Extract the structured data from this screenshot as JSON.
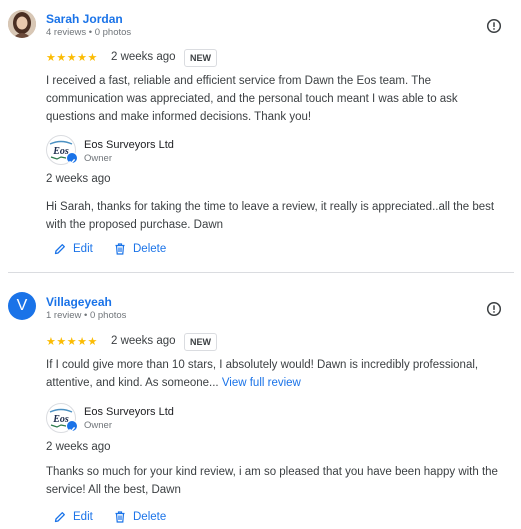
{
  "reviews": [
    {
      "name": "Sarah Jordan",
      "meta": "4 reviews • 0 photos",
      "avatar_letter": "",
      "stars": "★★★★★",
      "date": "2 weeks ago",
      "badge": "NEW",
      "text": "I received a fast, reliable and efficient service from Dawn the Eos team. The communication was appreciated, and the personal touch meant I was able to ask questions and make informed decisions. Thank you!",
      "view_full": "",
      "reply": {
        "owner_name": "Eos Surveyors Ltd",
        "owner_role": "Owner",
        "date": "2 weeks ago",
        "text": "Hi Sarah, thanks for taking the time to leave a review, it really is appreciated..all the best with the proposed purchase. Dawn"
      },
      "edit_label": "Edit",
      "delete_label": "Delete"
    },
    {
      "name": "Villageyeah",
      "meta": "1 review • 0 photos",
      "avatar_letter": "V",
      "stars": "★★★★★",
      "date": "2 weeks ago",
      "badge": "NEW",
      "text": "If I could give more than 10 stars, I absolutely would! Dawn is incredibly professional, attentive, and kind. As someone...",
      "view_full": "View full review",
      "reply": {
        "owner_name": "Eos Surveyors Ltd",
        "owner_role": "Owner",
        "date": "2 weeks ago",
        "text": "Thanks so much for your kind review, i am so pleased that you have been happy with the service! All the best, Dawn"
      },
      "edit_label": "Edit",
      "delete_label": "Delete"
    }
  ],
  "owner_logo_text": "Eos",
  "colors": {
    "accent": "#1a73e8",
    "star": "#fbbc04",
    "text": "#3c4043",
    "muted": "#70757a",
    "divider": "#dadce0"
  },
  "icons": {
    "more": "alert-circle-icon",
    "edit": "pencil-icon",
    "delete": "trash-icon",
    "verified": "check-badge-icon"
  }
}
